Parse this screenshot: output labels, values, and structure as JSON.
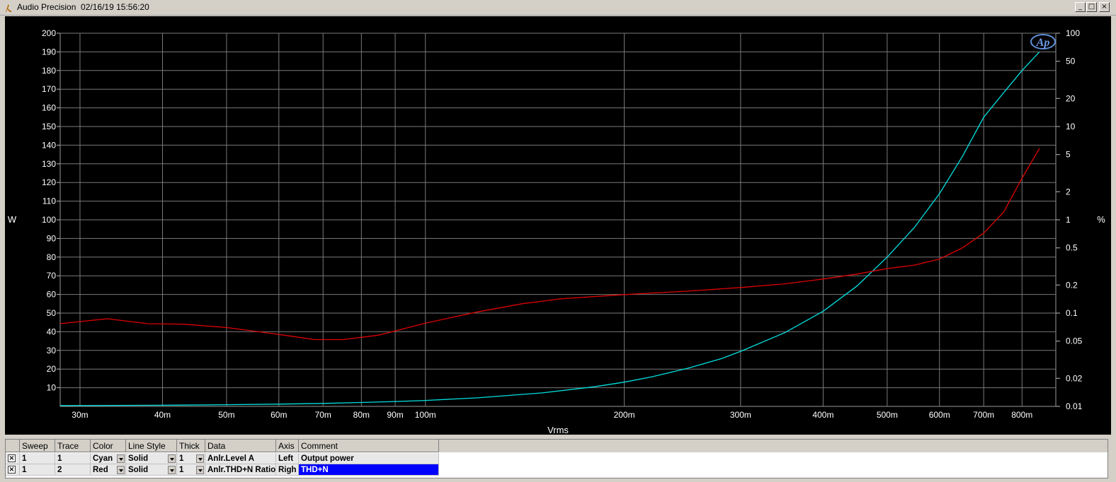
{
  "window": {
    "title": "Audio Precision  02/16/19 15:56:20",
    "minimize_glyph": "_",
    "restore_glyph": "□",
    "close_glyph": "×"
  },
  "logo": {
    "text": "Ap"
  },
  "chart_data": {
    "type": "line",
    "xlabel": "Vrms",
    "ylabel_left": "W",
    "ylabel_right": "%",
    "x_scale": "log",
    "xlim": [
      0.028,
      0.9
    ],
    "ylim_left": [
      0,
      200
    ],
    "ylim_right": [
      0.01,
      100
    ],
    "right_scale": "log",
    "grid": true,
    "x_ticks": [
      {
        "v": 0.03,
        "label": "30m"
      },
      {
        "v": 0.04,
        "label": "40m"
      },
      {
        "v": 0.05,
        "label": "50m"
      },
      {
        "v": 0.06,
        "label": "60m"
      },
      {
        "v": 0.07,
        "label": "70m"
      },
      {
        "v": 0.08,
        "label": "80m"
      },
      {
        "v": 0.09,
        "label": "90m"
      },
      {
        "v": 0.1,
        "label": "100m"
      },
      {
        "v": 0.2,
        "label": "200m"
      },
      {
        "v": 0.3,
        "label": "300m"
      },
      {
        "v": 0.4,
        "label": "400m"
      },
      {
        "v": 0.5,
        "label": "500m"
      },
      {
        "v": 0.6,
        "label": "600m"
      },
      {
        "v": 0.7,
        "label": "700m"
      },
      {
        "v": 0.8,
        "label": "800m"
      }
    ],
    "y_left_ticks": [
      {
        "v": 10,
        "label": "10"
      },
      {
        "v": 20,
        "label": "20"
      },
      {
        "v": 30,
        "label": "30"
      },
      {
        "v": 40,
        "label": "40"
      },
      {
        "v": 50,
        "label": "50"
      },
      {
        "v": 60,
        "label": "60"
      },
      {
        "v": 70,
        "label": "70"
      },
      {
        "v": 80,
        "label": "80"
      },
      {
        "v": 90,
        "label": "90"
      },
      {
        "v": 100,
        "label": "100"
      },
      {
        "v": 110,
        "label": "110"
      },
      {
        "v": 120,
        "label": "120"
      },
      {
        "v": 130,
        "label": "130"
      },
      {
        "v": 140,
        "label": "140"
      },
      {
        "v": 150,
        "label": "150"
      },
      {
        "v": 160,
        "label": "160"
      },
      {
        "v": 170,
        "label": "170"
      },
      {
        "v": 180,
        "label": "180"
      },
      {
        "v": 190,
        "label": "190"
      },
      {
        "v": 200,
        "label": "200"
      }
    ],
    "y_right_ticks": [
      {
        "v": 0.01,
        "label": "0.01"
      },
      {
        "v": 0.02,
        "label": "0.02"
      },
      {
        "v": 0.05,
        "label": "0.05"
      },
      {
        "v": 0.1,
        "label": "0.1"
      },
      {
        "v": 0.2,
        "label": "0.2"
      },
      {
        "v": 0.5,
        "label": "0.5"
      },
      {
        "v": 1,
        "label": "1"
      },
      {
        "v": 2,
        "label": "2"
      },
      {
        "v": 5,
        "label": "5"
      },
      {
        "v": 10,
        "label": "10"
      },
      {
        "v": 20,
        "label": "20"
      },
      {
        "v": 50,
        "label": "50"
      },
      {
        "v": 100,
        "label": "100"
      }
    ],
    "series": [
      {
        "axis": "left",
        "color": "#00e0e0",
        "x": [
          0.028,
          0.04,
          0.05,
          0.06,
          0.07,
          0.08,
          0.09,
          0.1,
          0.12,
          0.15,
          0.18,
          0.2,
          0.22,
          0.25,
          0.28,
          0.3,
          0.35,
          0.4,
          0.45,
          0.5,
          0.55,
          0.6,
          0.65,
          0.7,
          0.75,
          0.8,
          0.85
        ],
        "y": [
          0.4,
          0.6,
          0.9,
          1.2,
          1.6,
          2.1,
          2.6,
          3.2,
          4.6,
          7.2,
          10.5,
          13,
          15.8,
          20.5,
          25.5,
          29.5,
          39.5,
          51,
          64.5,
          80,
          96,
          114,
          134,
          155,
          168,
          180,
          190
        ]
      },
      {
        "axis": "right",
        "color": "#e00000",
        "x": [
          0.028,
          0.033,
          0.038,
          0.043,
          0.05,
          0.06,
          0.068,
          0.075,
          0.085,
          0.1,
          0.12,
          0.14,
          0.16,
          0.2,
          0.25,
          0.3,
          0.35,
          0.4,
          0.45,
          0.5,
          0.55,
          0.6,
          0.65,
          0.7,
          0.75,
          0.8,
          0.85
        ],
        "y": [
          0.077,
          0.087,
          0.077,
          0.076,
          0.07,
          0.059,
          0.052,
          0.052,
          0.058,
          0.078,
          0.103,
          0.126,
          0.142,
          0.158,
          0.172,
          0.188,
          0.206,
          0.232,
          0.262,
          0.3,
          0.327,
          0.38,
          0.5,
          0.72,
          1.2,
          2.8,
          5.8
        ]
      }
    ]
  },
  "trace_table": {
    "headers": [
      "",
      "Sweep",
      "Trace",
      "Color",
      "Line Style",
      "Thick",
      "Data",
      "Axis",
      "Comment"
    ],
    "rows": [
      {
        "checked": "×",
        "sweep": "1",
        "trace": "1",
        "color": "Cyan",
        "line_style": "Solid",
        "thick": "1",
        "data": "Anlr.Level A",
        "axis": "Left",
        "comment": "Output power"
      },
      {
        "checked": "×",
        "sweep": "1",
        "trace": "2",
        "color": "Red",
        "line_style": "Solid",
        "thick": "1",
        "data": "Anlr.THD+N Ratio",
        "axis": "Righ",
        "comment": "THD+N"
      }
    ]
  }
}
